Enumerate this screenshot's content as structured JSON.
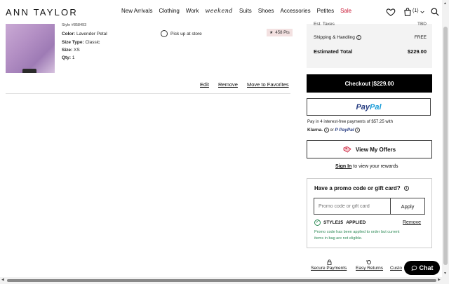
{
  "header": {
    "logo": "ANN TAYLOR",
    "nav": [
      "New Arrivals",
      "Clothing",
      "Work",
      "weekend",
      "Suits",
      "Shoes",
      "Accessories",
      "Petites",
      "Sale"
    ],
    "bag_count": "(1)",
    "sale_color": "#c8102e"
  },
  "item": {
    "style": "Style #858493",
    "color_label": "Color:",
    "color_value": "Lavender Petal",
    "size_type_label": "Size Type:",
    "size_type_value": "Classic",
    "size_label": "Size:",
    "size_value": "XS",
    "qty_label": "Qty:",
    "qty_value": "1",
    "pickup": "Pick up at store",
    "points": "458 Pts",
    "edit": "Edit",
    "remove": "Remove",
    "move": "Move to Favorites"
  },
  "summary": {
    "tax_label": "Est. Taxes",
    "tax_value": "TBD",
    "shipping_label": "Shipping & Handling",
    "shipping_value": "FREE",
    "total_label": "Estimated Total",
    "total_value": "$229.00",
    "checkout": "Checkout |$229.00",
    "paypal_1": "Pay",
    "paypal_2": "Pal",
    "paylater_text": "Pay in 4 interest-free payments of $57.25 with",
    "klarna": "Klarna.",
    "or": "or",
    "paypal_small": "PayPal",
    "offers": "View My Offers",
    "signin_link": "Sign In",
    "signin_text": " to view your rewards"
  },
  "promo": {
    "title": "Have a promo code or gift card?",
    "placeholder": "Promo code or gift card",
    "apply": "Apply",
    "code": "STYLE25",
    "applied": "APPLIED",
    "remove": "Remove",
    "message": "Promo code has been applied to order but current items in bag are not eligible."
  },
  "footer": {
    "secure": "Secure Payments",
    "returns": "Easy Returns",
    "customer": "Custo",
    "chat": "Chat"
  }
}
